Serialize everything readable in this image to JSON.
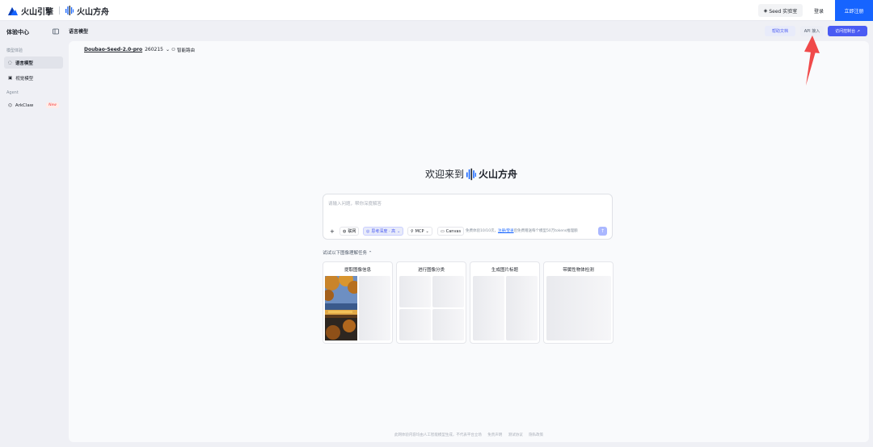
{
  "topbar": {
    "brand1": "火山引擎",
    "brand2": "火山方舟",
    "seed_label": "Seed 实验室",
    "login_label": "登录",
    "register_label": "立即注册"
  },
  "sidebar": {
    "title": "体验中心",
    "section1": "模型体验",
    "items": [
      {
        "label": "语言模型"
      },
      {
        "label": "视觉模型"
      }
    ],
    "section2": "Agent",
    "agent_item": {
      "label": "ArkClaw",
      "badge": "New"
    }
  },
  "header": {
    "page_title": "语言模型",
    "help_doc": "帮助文档",
    "api_access": "API 接入",
    "console": "访问控制台 ↗"
  },
  "model_bar": {
    "model_name": "Doubao-Seed-2.0-pro",
    "model_version": "260215",
    "smart_route": "智能路由"
  },
  "welcome": {
    "prefix": "欢迎来到",
    "brand": "火山方舟"
  },
  "chat": {
    "placeholder": "请输入问题，帮你深度解答",
    "tools": {
      "plus": "+",
      "web": "联网",
      "think": "思考深度 · 高",
      "mcp": "MCP",
      "canvas": "Canvas"
    },
    "hint_pre": "免费体验10/10次，",
    "hint_link": "注册/登录",
    "hint_post": "后免费赠送每个模型50万tokens推理额"
  },
  "tasks": {
    "title": "试试以下图像理解任务 ⌃",
    "cards": [
      {
        "label": "提取图像信息"
      },
      {
        "label": "进行图像分类"
      },
      {
        "label": "生成图片标题"
      },
      {
        "label": "带属性物体检测"
      }
    ]
  },
  "footer": {
    "notice": "此网体验内容均由人工智能模型生成，不代表平台立场",
    "disclaimer": "免责声明",
    "terms": "测试协议",
    "privacy": "隐私政策"
  },
  "colors": {
    "accent": "#1664ff",
    "console_button": "#4a5bf3",
    "arrow": "#f04a4a"
  }
}
